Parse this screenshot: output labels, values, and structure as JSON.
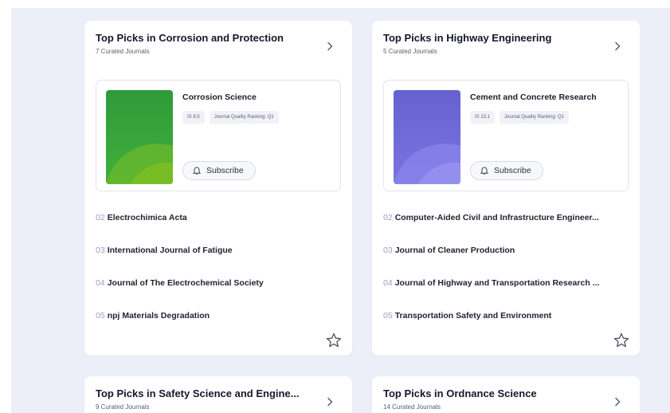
{
  "cards": [
    {
      "title": "Top Picks in Corrosion and Protection",
      "subtitle": "7 Curated Journals",
      "featured": {
        "name": "Corrosion Science",
        "tags": [
          "IS 8.5",
          "Journal Quality Ranking: Q1"
        ],
        "subscribe_label": "Subscribe",
        "cover_color": "#3aa63a"
      },
      "list": [
        {
          "rank": "02",
          "name": "Electrochimica Acta"
        },
        {
          "rank": "03",
          "name": "International Journal of Fatigue"
        },
        {
          "rank": "04",
          "name": "Journal of The Electrochemical Society"
        },
        {
          "rank": "05",
          "name": "npj Materials Degradation"
        }
      ]
    },
    {
      "title": "Top Picks in Highway Engineering",
      "subtitle": "5 Curated Journals",
      "featured": {
        "name": "Cement and Concrete Research",
        "tags": [
          "IS 13.1",
          "Journal Quality Ranking: Q1"
        ],
        "subscribe_label": "Subscribe",
        "cover_color": "#6f6ad6"
      },
      "list": [
        {
          "rank": "02",
          "name": "Computer-Aided Civil and Infrastructure Engineer..."
        },
        {
          "rank": "03",
          "name": "Journal of Cleaner Production"
        },
        {
          "rank": "04",
          "name": "Journal of Highway and Transportation Research ..."
        },
        {
          "rank": "05",
          "name": "Transportation Safety and Environment"
        }
      ]
    },
    {
      "title": "Top Picks in Safety Science and Engine...",
      "subtitle": "9 Curated Journals"
    },
    {
      "title": "Top Picks in Ordnance Science",
      "subtitle": "14 Curated Journals"
    }
  ],
  "icons": {
    "chevron": "chevron-right-icon",
    "star": "star-outline-icon",
    "subscribe": "bell-icon"
  }
}
